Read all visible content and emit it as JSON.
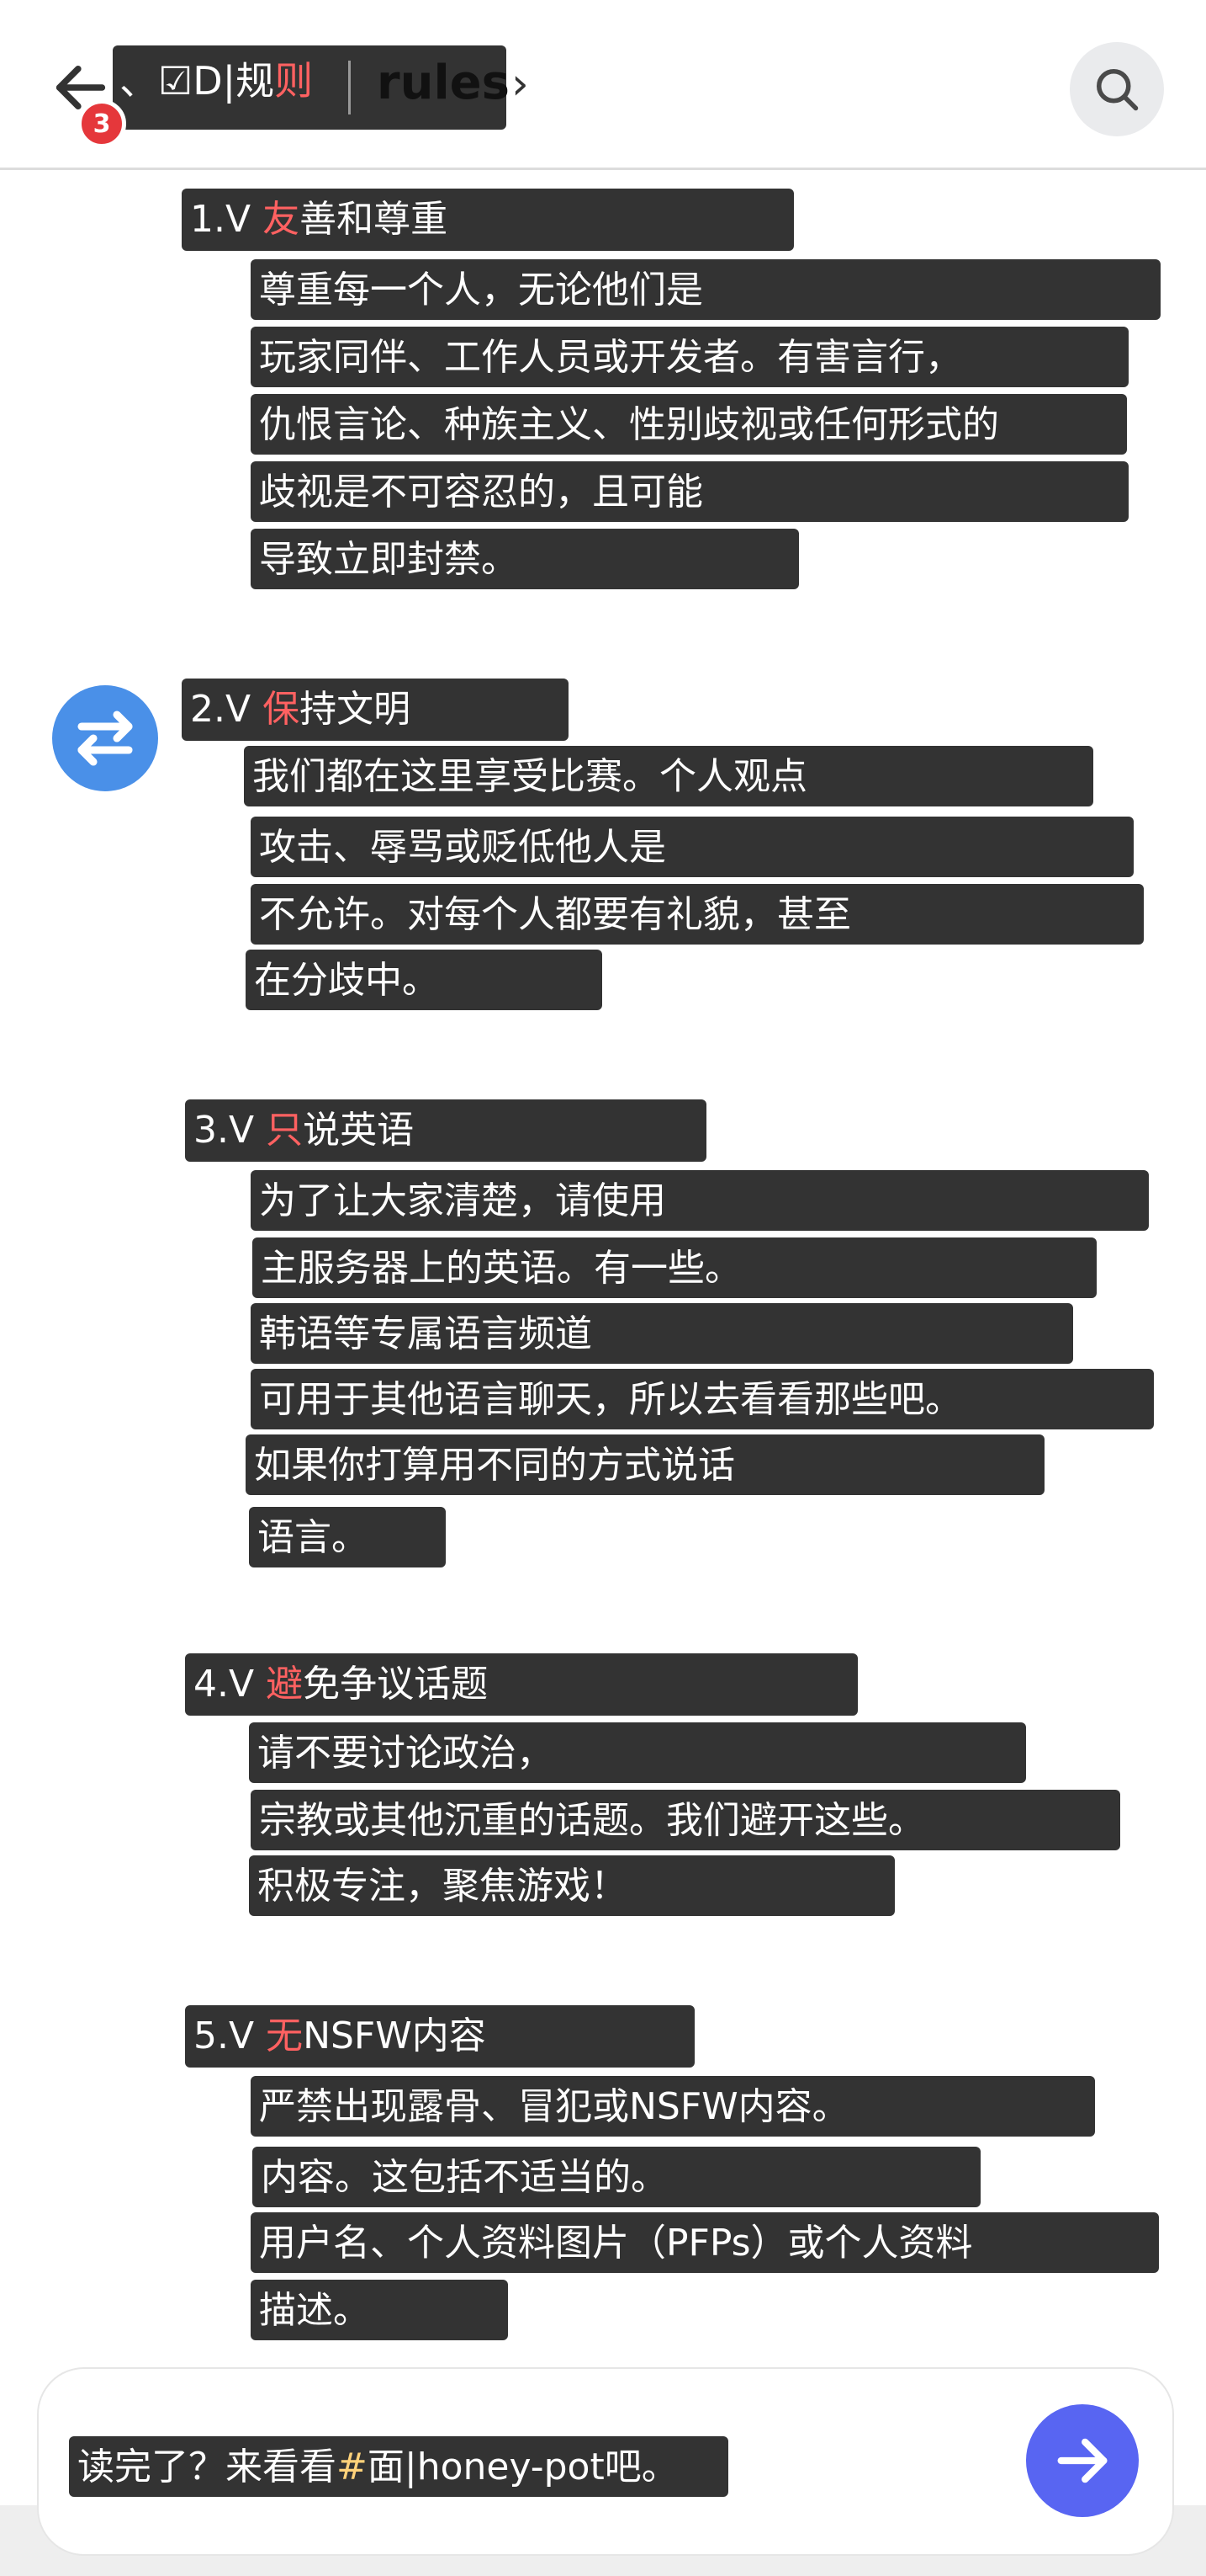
{
  "header": {
    "back_icon": "arrow-left-icon",
    "badge_count": "3",
    "channel_prefix": "、☑D|规",
    "channel_suffix": "则",
    "channel_name": "rules",
    "chevron": "›",
    "search_icon": "search-icon"
  },
  "rules": [
    {
      "number": "1.V ",
      "first_char": "友",
      "title_rest": "善和尊重",
      "lines": [
        "尊重每一个人，无论他们是",
        "玩家同伴、工作人员或开发者。有害言行，",
        "仇恨言论、种族主义、性别歧视或任何形式的",
        "歧视是不可容忍的，且可能",
        "导致立即封禁。"
      ]
    },
    {
      "number": "2.V ",
      "first_char": "保",
      "title_rest": "持文明",
      "lines": [
        "我们都在这里享受比赛。个人观点",
        "攻击、辱骂或贬低他人是",
        "不允许。对每个人都要有礼貌，甚至",
        "在分歧中。"
      ]
    },
    {
      "number": "3.V ",
      "first_char": "只",
      "title_rest": "说英语",
      "lines": [
        "为了让大家清楚，请使用",
        "主服务器上的英语。有一些。",
        "韩语等专属语言频道",
        "可用于其他语言聊天，所以去看看那些吧。",
        "如果你打算用不同的方式说话",
        "语言。"
      ]
    },
    {
      "number": "4.V ",
      "first_char": "避",
      "title_rest": "免争议话题",
      "lines": [
        "请不要讨论政治，",
        "宗教或其他沉重的话题。我们避开这些。",
        "积极专注，聚焦游戏！"
      ]
    },
    {
      "number": "5.V ",
      "first_char": "无",
      "title_rest": "NSFW内容",
      "lines": [
        "严禁出现露骨、冒犯或NSFW内容。",
        "内容。这包括不适当的。",
        "用户名、个人资料图片（PFPs）或个人资料",
        "描述。"
      ]
    }
  ],
  "composer": {
    "text_before": "读完了？来看看",
    "link_hash": "#",
    "text_after": "面|honey-pot吧。",
    "send_icon": "arrow-right-icon"
  },
  "avatar_icon": "swap-arrows-icon",
  "colors": {
    "overlay": "#333333",
    "accent_red": "#ff6161",
    "badge_red": "#e5373b",
    "send_blue": "#5865f2",
    "avatar_blue": "#4a90e8"
  }
}
